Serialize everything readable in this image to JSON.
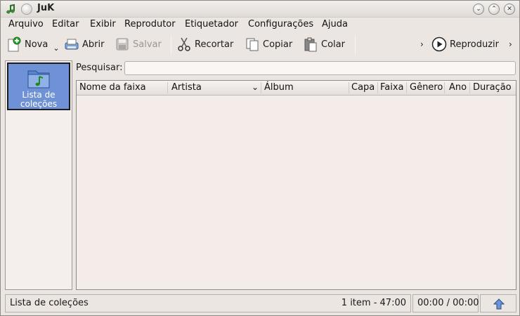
{
  "window": {
    "title": "JuK"
  },
  "menubar": {
    "items": [
      "Arquivo",
      "Editar",
      "Exibir",
      "Reprodutor",
      "Etiquetador",
      "Configurações",
      "Ajuda"
    ]
  },
  "toolbar": {
    "new_label": "Nova",
    "open_label": "Abrir",
    "save_label": "Salvar",
    "cut_label": "Recortar",
    "copy_label": "Copiar",
    "paste_label": "Colar",
    "more_label": "›",
    "play_label": "Reproduzir",
    "more2_label": "›"
  },
  "sidebar": {
    "items": [
      {
        "label": "Lista de coleções"
      }
    ]
  },
  "search": {
    "label": "Pesquisar:",
    "value": ""
  },
  "tracklist": {
    "columns": [
      "Nome da faixa",
      "Artista",
      "Álbum",
      "Capa",
      "Faixa",
      "Gênero",
      "Ano",
      "Duração"
    ],
    "sort_indicator": "⌄",
    "rows": []
  },
  "statusbar": {
    "playlist_name": "Lista de coleções",
    "item_count": "1 item - 47:00",
    "time": "00:00 / 00:00"
  },
  "colors": {
    "selection": "#6f92d6",
    "window_bg": "#ebe6e2",
    "list_bg": "#f4ece9"
  }
}
